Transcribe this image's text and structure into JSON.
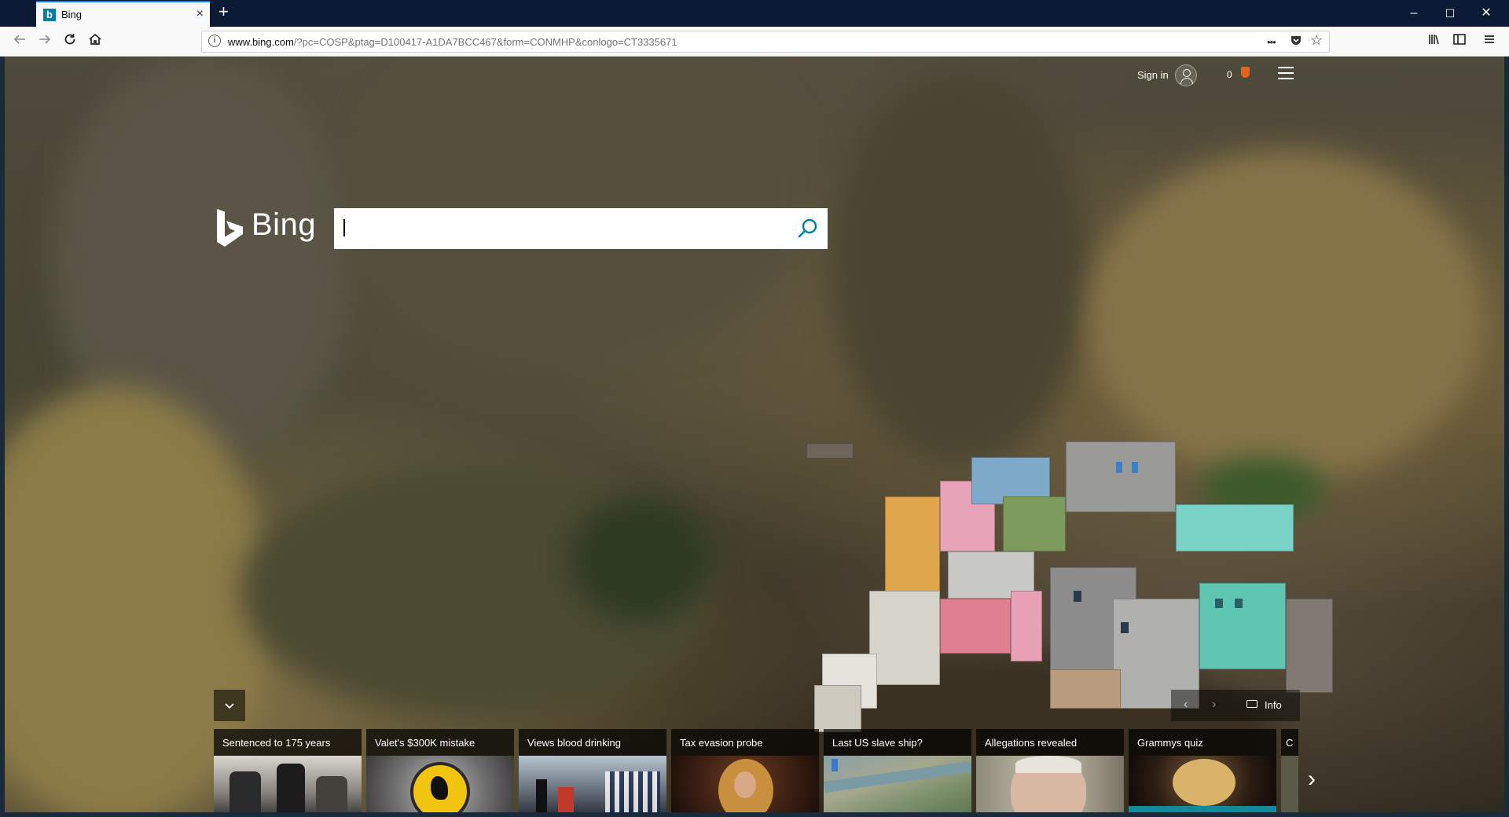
{
  "browser": {
    "tab": {
      "title": "Bing",
      "favicon": "b"
    },
    "new_tab_label": "+",
    "window_controls": {
      "minimize": "–",
      "maximize": "☐",
      "close": "✕"
    },
    "address": {
      "host": "www.bing.com",
      "path": "/?pc=COSP&ptag=D100417-A1DA7BCC467&form=CONMHP&conlogo=CT3335671"
    },
    "nav_icons": [
      "back-arrow-icon",
      "forward-arrow-icon",
      "reload-icon",
      "home-icon"
    ],
    "url_actions": {
      "more": "•••",
      "pocket": "pocket-icon",
      "bookmark": "☆"
    },
    "toolbar_icons": [
      "library-icon",
      "sidebar-icon",
      "menu-icon"
    ]
  },
  "header": {
    "sign_in": "Sign in",
    "rewards_count": "0"
  },
  "logo_text": "Bing",
  "search": {
    "value": ""
  },
  "carousel": {
    "prev": "‹",
    "next": "›",
    "info": "Info"
  },
  "expand_icon": "chevron-down-icon",
  "news": [
    {
      "title": "Sentenced to 175 years",
      "thumb": "courtroom"
    },
    {
      "title": "Valet's $300K mistake",
      "thumb": "ferrari-badge"
    },
    {
      "title": "Views blood drinking",
      "thumb": "ceremony"
    },
    {
      "title": "Tax evasion probe",
      "thumb": "singer"
    },
    {
      "title": "Last US slave ship?",
      "thumb": "river-aerial"
    },
    {
      "title": "Allegations revealed",
      "thumb": "portrait"
    },
    {
      "title": "Grammys quiz",
      "thumb": "performer"
    },
    {
      "title": "C",
      "thumb": "partial"
    }
  ],
  "news_next": "›",
  "colors": {
    "tab_accent": "#0a84ff",
    "title_bar": "#0c1b35",
    "bing_teal": "#00809d",
    "rewards_orange": "#e8631a"
  }
}
